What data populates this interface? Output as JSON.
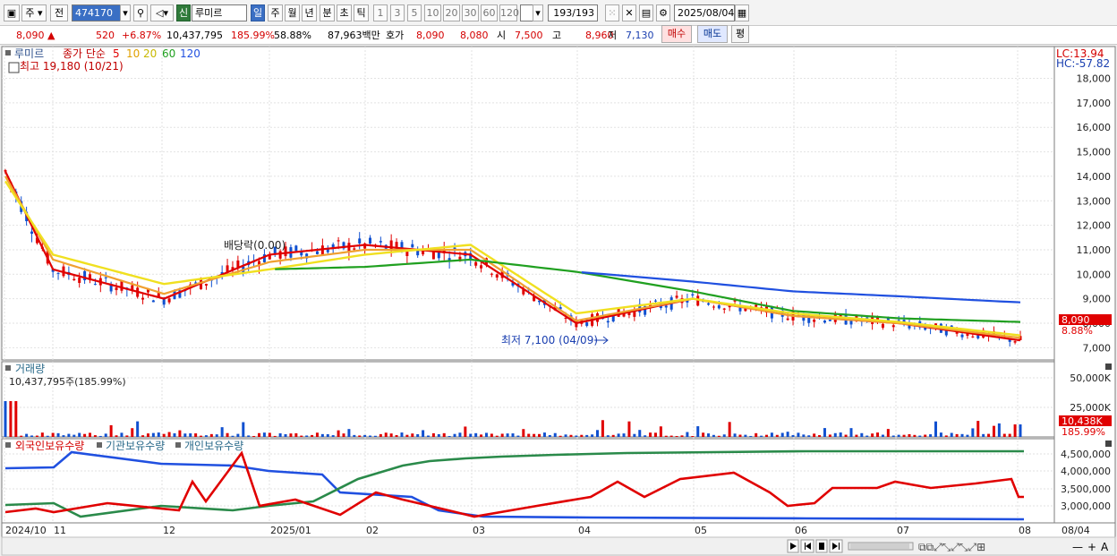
{
  "toolbar": {
    "type_label": "주",
    "prev_label": "전",
    "code": "474170",
    "stock_badge": "신",
    "stock_name": "루미르",
    "periods": [
      "일",
      "주",
      "월",
      "년",
      "분",
      "초",
      "틱"
    ],
    "numbers": [
      "1",
      "3",
      "5",
      "10",
      "20",
      "30",
      "60",
      "120"
    ],
    "count": "193/193",
    "date": "2025/08/04"
  },
  "info": {
    "price": "8,090",
    "arrow": "▲",
    "change": "520",
    "rate": "+6.87%",
    "volume": "10,437,795",
    "vol_rate": "185.99%",
    "turnover": "58.88%",
    "amount": "87,963백만",
    "quote_label": "호가",
    "ask": "8,090",
    "bid": "8,080",
    "open_label": "시",
    "open": "7,500",
    "high_label": "고",
    "high": "8,960",
    "low_label": "저",
    "low": "7,130",
    "buy_label": "매수",
    "sell_label": "매도",
    "eval_label": "평"
  },
  "price_panel": {
    "name": "루미르",
    "ma_label": "종가 단순",
    "ma_periods": [
      "5",
      "10",
      "20",
      "60",
      "120"
    ],
    "max_note": "최고 19,180 (10/21)",
    "min_note": "최저 7,100 (04/09)",
    "dividend_note": "배당락(0.00)",
    "lc": "LC:13.94",
    "hc": "HC:-57.82",
    "y_ticks": [
      "18,000",
      "17,000",
      "16,000",
      "15,000",
      "14,000",
      "13,000",
      "12,000",
      "11,000",
      "10,000",
      "9,000",
      "8,000",
      "7,000"
    ],
    "last_price": "8,090",
    "last_ma": "8.88%"
  },
  "volume_panel": {
    "title": "거래량",
    "value_note": "10,437,795주(185.99%)",
    "y_ticks": [
      "50,000K",
      "25,000K"
    ],
    "last_value": "10,438K",
    "last_rate": "185.99%"
  },
  "holding_panel": {
    "titles": [
      "외국인보유수량",
      "기관보유수량",
      "개인보유수량"
    ],
    "y_ticks": [
      "4,500,000",
      "4,000,000",
      "3,500,000",
      "3,000,000"
    ]
  },
  "x_axis": {
    "labels": [
      "2024/10",
      "11",
      "12",
      "2025/01",
      "02",
      "03",
      "04",
      "05",
      "06",
      "07",
      "08"
    ],
    "right_label": "08/04"
  },
  "colors": {
    "ma5": "#e00000",
    "ma10": "#f0a030",
    "ma20": "#f0e020",
    "ma60": "#20a020",
    "ma120": "#2050e0",
    "up": "#e00000",
    "down": "#1050d0"
  },
  "chart_data": {
    "type": "line",
    "x": [
      "2024/10",
      "11",
      "12",
      "2025/01",
      "02",
      "03",
      "04",
      "05",
      "06",
      "07",
      "08"
    ],
    "series": [
      {
        "name": "5",
        "values": [
          14200,
          10200,
          9000,
          10800,
          11200,
          10800,
          8000,
          9000,
          8300,
          8000,
          7300
        ]
      },
      {
        "name": "10",
        "values": [
          14000,
          10600,
          9200,
          10500,
          11000,
          11000,
          8100,
          9000,
          8300,
          8000,
          7400
        ]
      },
      {
        "name": "20",
        "values": [
          13800,
          10800,
          9600,
          10200,
          10800,
          11200,
          8400,
          9000,
          8400,
          8050,
          7500
        ]
      },
      {
        "name": "60",
        "values": [
          null,
          null,
          null,
          10200,
          10300,
          10600,
          10100,
          9300,
          8500,
          8200,
          8050
        ]
      },
      {
        "name": "120",
        "values": [
          null,
          null,
          null,
          null,
          null,
          null,
          10100,
          9700,
          9300,
          9100,
          8850
        ]
      }
    ],
    "ylim": [
      6500,
      19300
    ],
    "title": "",
    "xlabel": "",
    "ylabel": ""
  }
}
